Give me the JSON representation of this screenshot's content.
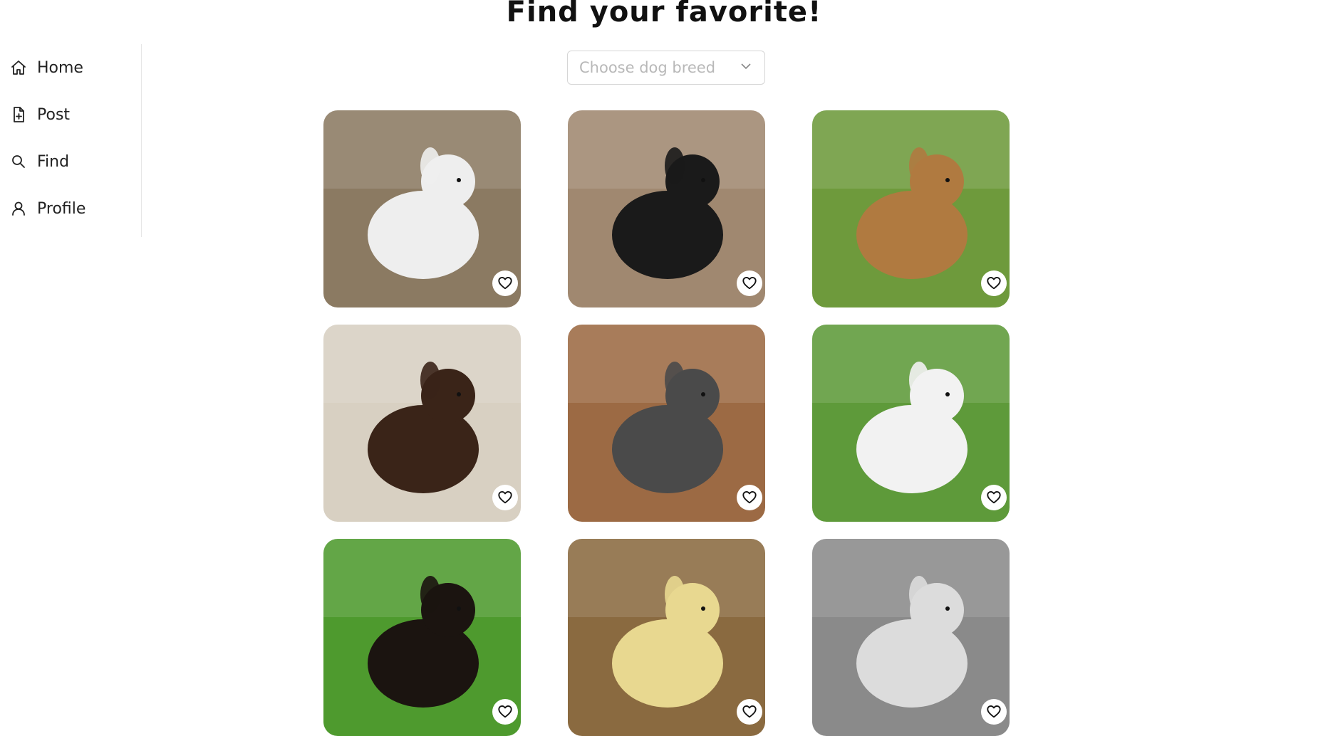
{
  "page": {
    "title": "Find your favorite!"
  },
  "sidebar": {
    "items": [
      {
        "label": "Home",
        "icon": "home-icon"
      },
      {
        "label": "Post",
        "icon": "file-plus-icon"
      },
      {
        "label": "Find",
        "icon": "search-icon"
      },
      {
        "label": "Profile",
        "icon": "user-icon"
      }
    ]
  },
  "filter": {
    "placeholder": "Choose dog breed",
    "icon": "chevron-down-icon"
  },
  "dogs": [
    {
      "subject": "white poodle",
      "bg": "#8b7a62",
      "fg": "#eeeeee"
    },
    {
      "subject": "black shepherd",
      "bg": "#a08870",
      "fg": "#1a1a1a"
    },
    {
      "subject": "tan dachshund",
      "bg": "#6e9a3c",
      "fg": "#b07a40"
    },
    {
      "subject": "brown water spaniel",
      "bg": "#d8d0c2",
      "fg": "#3a2418"
    },
    {
      "subject": "cattle dog puppy",
      "bg": "#9c6a44",
      "fg": "#4a4a4a"
    },
    {
      "subject": "fox terrier",
      "bg": "#5e9a3a",
      "fg": "#f2f2f2"
    },
    {
      "subject": "bernese puppy",
      "bg": "#4e9a2e",
      "fg": "#1b1410"
    },
    {
      "subject": "dog in bed",
      "bg": "#8a6a40",
      "fg": "#e8d890"
    },
    {
      "subject": "grayscale dog",
      "bg": "#8a8a8a",
      "fg": "#dcdcdc"
    }
  ],
  "colors": {
    "border": "#e6e6e6",
    "placeholder": "#b8b8b8"
  }
}
